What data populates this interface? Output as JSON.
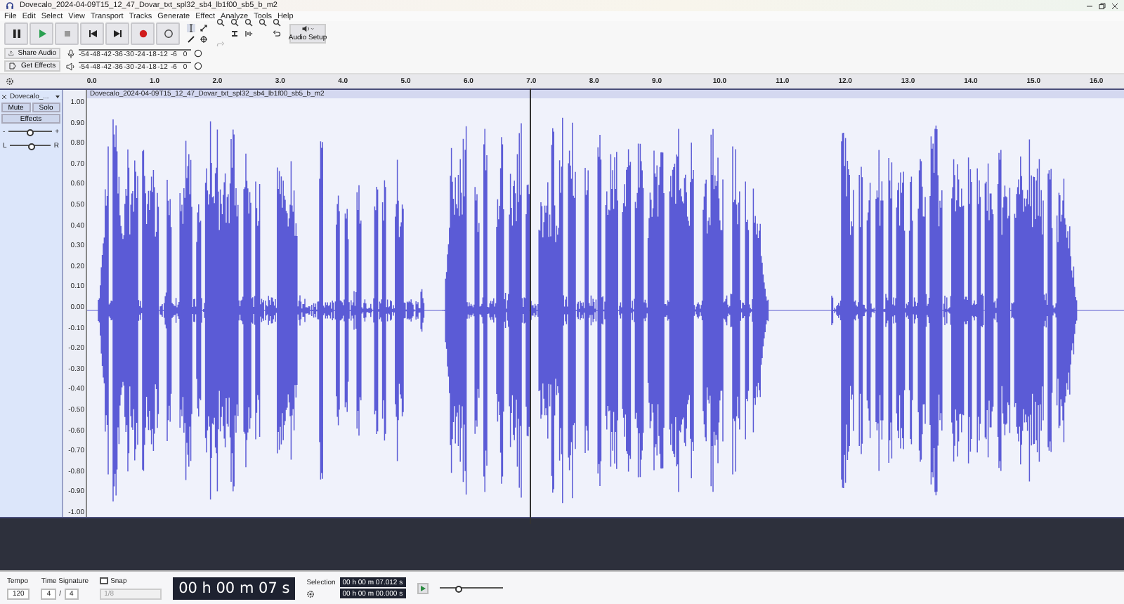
{
  "window": {
    "title": "Dovecalo_2024-04-09T15_12_47_Dovar_txt_spl32_sb4_lb1f00_sb5_b_m2"
  },
  "menu": [
    "File",
    "Edit",
    "Select",
    "View",
    "Transport",
    "Tracks",
    "Generate",
    "Effect",
    "Analyze",
    "Tools",
    "Help"
  ],
  "transport_buttons": [
    {
      "kind": "pause"
    },
    {
      "kind": "play"
    },
    {
      "kind": "stop"
    },
    {
      "kind": "skip_start"
    },
    {
      "kind": "skip_end"
    },
    {
      "kind": "record"
    },
    {
      "kind": "loop"
    }
  ],
  "audio_setup": "Audio Setup",
  "share_audio": "Share Audio",
  "get_effects": "Get Effects",
  "meters": [
    {
      "kind": "record",
      "scale": [
        "-54",
        "-48",
        "-42",
        "-36",
        "-30",
        "-24",
        "-18",
        "-12",
        "-6",
        "0"
      ]
    },
    {
      "kind": "playback",
      "scale": [
        "-54",
        "-48",
        "-42",
        "-36",
        "-30",
        "-24",
        "-18",
        "-12",
        "-6",
        "0"
      ]
    }
  ],
  "ruler": [
    "0.0",
    "1.0",
    "2.0",
    "3.0",
    "4.0",
    "5.0",
    "6.0",
    "7.0",
    "8.0",
    "9.0",
    "10.0",
    "11.0",
    "12.0",
    "13.0",
    "14.0",
    "15.0",
    "16.0"
  ],
  "track": {
    "name": "Dovecalo_...",
    "clip_title": "Dovecalo_2024-04-09T15_12_47_Dovar_txt_spl32_sb4_lb1f00_sb5_b_m2",
    "buttons": [
      "Mute",
      "Solo"
    ],
    "effects": "Effects",
    "gain": {
      "minus": "-",
      "plus": "+",
      "level": 0.5
    },
    "pan": {
      "left": "L",
      "right": "R",
      "level": 0.5
    },
    "scale": [
      "1.00",
      "0.90",
      "0.80",
      "0.70",
      "0.60",
      "0.50",
      "0.40",
      "0.30",
      "0.20",
      "0.10",
      "0.00",
      "-0.10",
      "-0.20",
      "-0.30",
      "-0.40",
      "-0.50",
      "-0.60",
      "-0.70",
      "-0.80",
      "-0.90",
      "-1.00"
    ]
  },
  "bottom": {
    "tempo_label": "Tempo",
    "tempo": "120",
    "time_signature_label": "Time Signature",
    "beats": "4",
    "slash": "/",
    "unit": "4",
    "snap_label": "Snap",
    "snap_checked": false,
    "snap_value": "1/8",
    "time": "00 h 00 m 07 s",
    "selection_label": "Selection",
    "selection_start": "00 h 00 m 07.012 s",
    "selection_end": "00 h 00 m 00.000 s",
    "speed": {
      "level": 0.3
    }
  }
}
